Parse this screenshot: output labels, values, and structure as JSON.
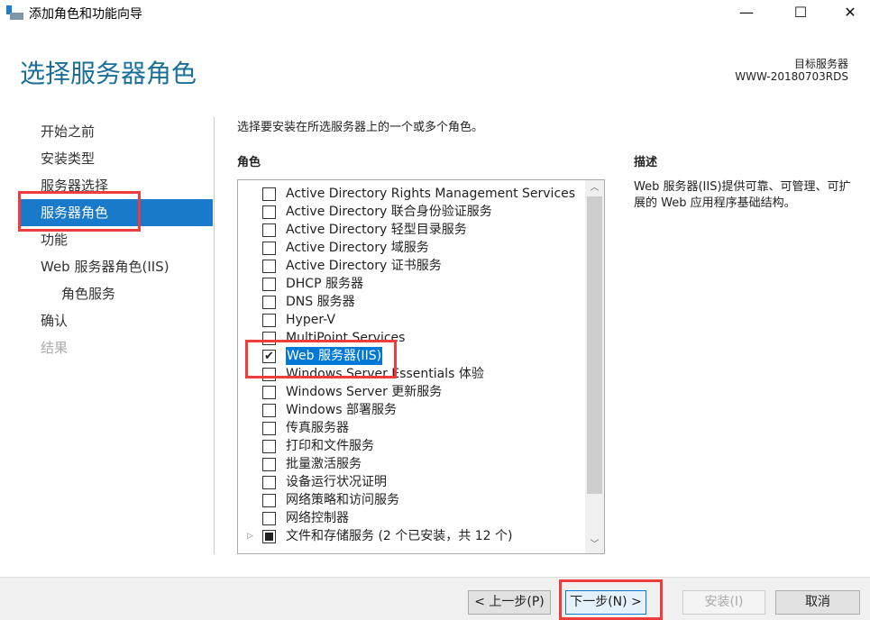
{
  "window": {
    "title": "添加角色和功能向导",
    "minimize": "—",
    "maximize": "☐",
    "close": "✕"
  },
  "header": {
    "title": "选择服务器角色",
    "target_label": "目标服务器",
    "target_name": "WWW-20180703RDS"
  },
  "nav": [
    {
      "label": "开始之前",
      "state": "normal"
    },
    {
      "label": "安装类型",
      "state": "normal"
    },
    {
      "label": "服务器选择",
      "state": "normal"
    },
    {
      "label": "服务器角色",
      "state": "selected"
    },
    {
      "label": "功能",
      "state": "normal"
    },
    {
      "label": "Web 服务器角色(IIS)",
      "state": "normal"
    },
    {
      "label": "角色服务",
      "state": "normal"
    },
    {
      "label": "确认",
      "state": "normal"
    },
    {
      "label": "结果",
      "state": "disabled"
    }
  ],
  "main": {
    "intro": "选择要安装在所选服务器上的一个或多个角色。",
    "roles_heading": "角色",
    "description_heading": "描述",
    "description": "Web 服务器(IIS)提供可靠、可管理、可扩展的 Web 应用程序基础结构。",
    "roles": [
      {
        "label": "Active Directory Rights Management Services",
        "checked": false
      },
      {
        "label": "Active Directory 联合身份验证服务",
        "checked": false
      },
      {
        "label": "Active Directory 轻型目录服务",
        "checked": false
      },
      {
        "label": "Active Directory 域服务",
        "checked": false
      },
      {
        "label": "Active Directory 证书服务",
        "checked": false
      },
      {
        "label": "DHCP 服务器",
        "checked": false
      },
      {
        "label": "DNS 服务器",
        "checked": false
      },
      {
        "label": "Hyper-V",
        "checked": false
      },
      {
        "label": "MultiPoint Services",
        "checked": false
      },
      {
        "label": "Web 服务器(IIS)",
        "checked": true
      },
      {
        "label": "Windows Server Essentials 体验",
        "checked": false
      },
      {
        "label": "Windows Server 更新服务",
        "checked": false
      },
      {
        "label": "Windows 部署服务",
        "checked": false
      },
      {
        "label": "传真服务器",
        "checked": false
      },
      {
        "label": "打印和文件服务",
        "checked": false
      },
      {
        "label": "批量激活服务",
        "checked": false
      },
      {
        "label": "设备运行状况证明",
        "checked": false
      },
      {
        "label": "网络策略和访问服务",
        "checked": false
      },
      {
        "label": "网络控制器",
        "checked": false
      },
      {
        "label": "文件和存储服务 (2 个已安装，共 12 个)",
        "checked": "partial",
        "expandable": true
      }
    ]
  },
  "footer": {
    "prev": "< 上一步(P)",
    "next": "下一步(N) >",
    "install": "安装(I)",
    "cancel": "取消"
  },
  "colors": {
    "accent": "#1979ca",
    "highlight": "#f03c3c",
    "title": "#1a6f9a"
  }
}
